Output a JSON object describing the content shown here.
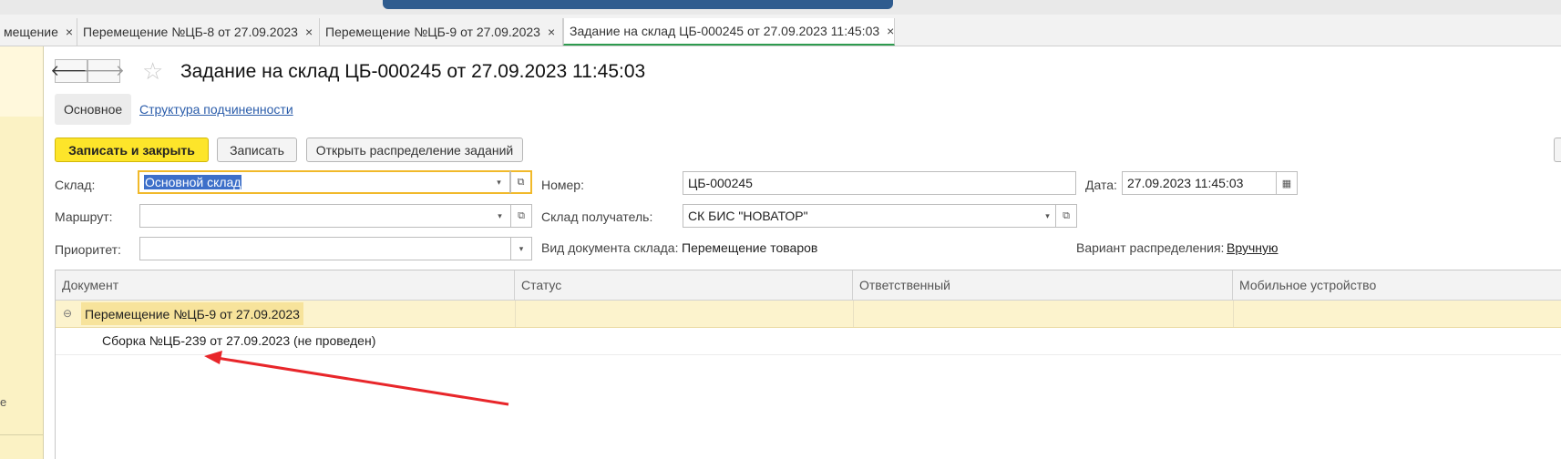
{
  "tabs": [
    {
      "label": "мещение",
      "close": "×"
    },
    {
      "label": "Перемещение №ЦБ-8 от 27.09.2023",
      "close": "×"
    },
    {
      "label": "Перемещение №ЦБ-9 от 27.09.2023",
      "close": "×"
    },
    {
      "label": "Задание на склад ЦБ-000245 от 27.09.2023 11:45:03",
      "close": "×"
    }
  ],
  "left_panel": {
    "partial_text": "e"
  },
  "nav": {
    "back": "🡐",
    "forward": "🡒",
    "star": "☆"
  },
  "title": "Задание на склад ЦБ-000245 от 27.09.2023 11:45:03",
  "subnav": {
    "main": "Основное",
    "structure": "Структура подчиненности"
  },
  "toolbar": {
    "save_close": "Записать и закрыть",
    "save": "Записать",
    "open_distribution": "Открыть распределение заданий"
  },
  "form": {
    "warehouse_label": "Склад:",
    "warehouse_value": "Основной склад",
    "route_label": "Маршрут:",
    "route_value": "",
    "priority_label": "Приоритет:",
    "priority_value": "",
    "number_label": "Номер:",
    "number_value": "ЦБ-000245",
    "receiver_label": "Склад получатель:",
    "receiver_value": "СК БИС \"НОВАТОР\"",
    "doc_type_label": "Вид документа склада:",
    "doc_type_value": "Перемещение товаров",
    "date_label": "Дата:",
    "date_value": "27.09.2023 11:45:03",
    "variant_label": "Вариант распределения:",
    "variant_value": "Вручную",
    "dropdown_glyph": "▾",
    "open_glyph": "⧉",
    "calendar_glyph": "▦"
  },
  "table": {
    "columns": [
      "Документ",
      "Статус",
      "Ответственный",
      "Мобильное устройство"
    ],
    "rows": [
      {
        "toggle": "⊖",
        "document": "Перемещение №ЦБ-9 от 27.09.2023",
        "status": "",
        "responsible": "",
        "device": ""
      },
      {
        "document": "Сборка №ЦБ-239 от 27.09.2023 (не проведен)",
        "status": "",
        "responsible": "",
        "device": ""
      }
    ]
  },
  "colors": {
    "accent_yellow": "#fde52a",
    "link_blue": "#2a5caa",
    "annotation_red": "#e8262a",
    "active_tab_green": "#2e9b4f"
  }
}
